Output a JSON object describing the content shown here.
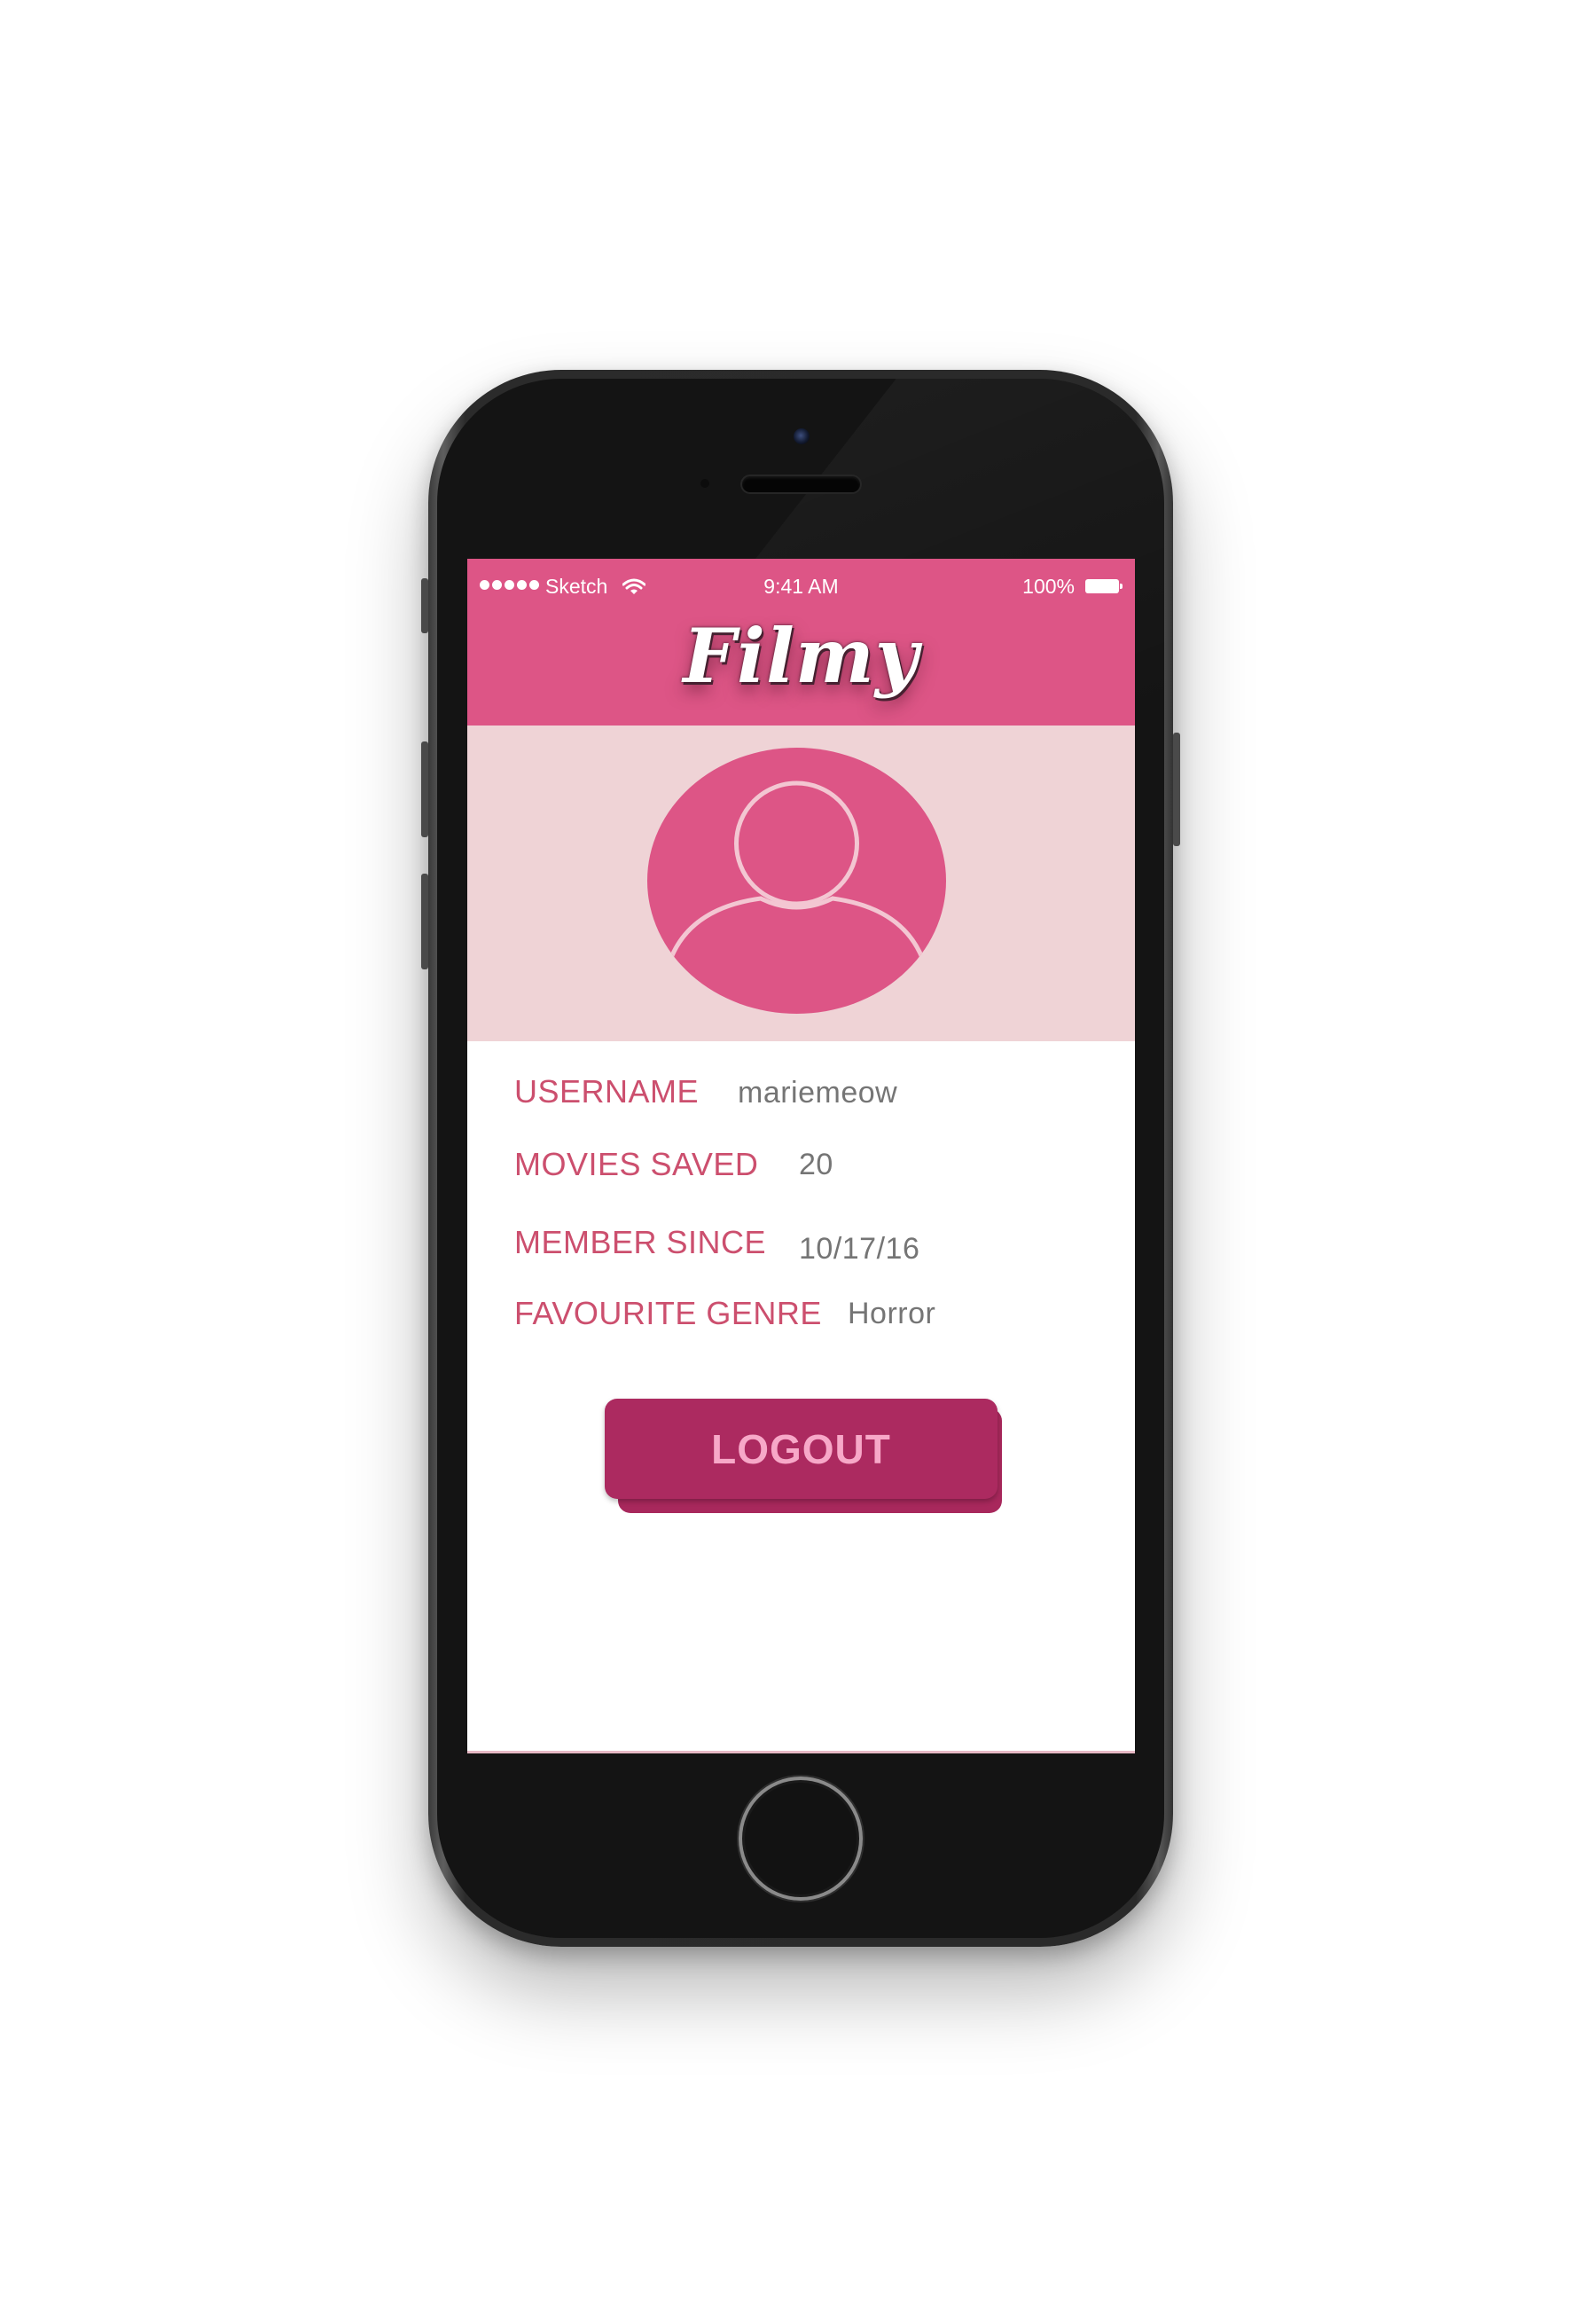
{
  "status_bar": {
    "carrier": "Sketch",
    "time": "9:41 AM",
    "battery": "100%"
  },
  "app": {
    "logo_text": "Filmy"
  },
  "profile": {
    "avatar_icon": "user-icon",
    "fields": [
      {
        "label": "USERNAME",
        "value": "mariemeow"
      },
      {
        "label": "MOVIES SAVED",
        "value": "20"
      },
      {
        "label": "MEMBER SINCE",
        "value": "10/17/16"
      },
      {
        "label": "FAVOURITE GENRE",
        "value": "Horror"
      }
    ]
  },
  "actions": {
    "logout_label": "LOGOUT"
  },
  "colors": {
    "header": "#dd5586",
    "banner": "#efd3d6",
    "label": "#cc4f6e",
    "value": "#757575",
    "button": "#ac2a60",
    "button_text": "#f7a8c8"
  }
}
